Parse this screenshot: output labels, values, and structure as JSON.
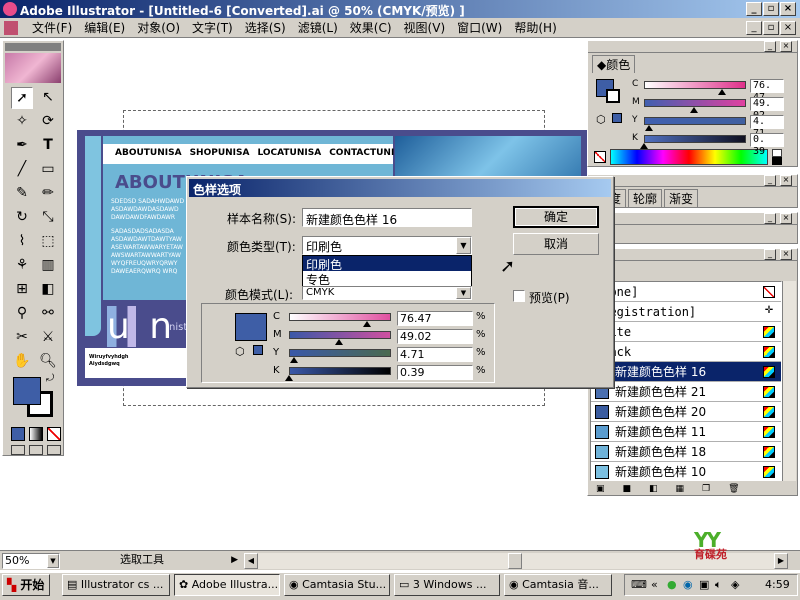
{
  "window": {
    "title": "Adobe Illustrator - [Untitled-6 [Converted].ai @ 50% (CMYK/预览) ]"
  },
  "menu": [
    "文件(F)",
    "编辑(E)",
    "对象(O)",
    "文字(T)",
    "选择(S)",
    "滤镜(L)",
    "效果(C)",
    "视图(V)",
    "窗口(W)",
    "帮助(H)"
  ],
  "colorPanel": {
    "tab": "颜色",
    "rows": [
      {
        "label": "C",
        "value": "76. 47"
      },
      {
        "label": "M",
        "value": "49. 02"
      },
      {
        "label": "Y",
        "value": "4. 71"
      },
      {
        "label": "K",
        "value": "0. 39"
      }
    ]
  },
  "panel2": {
    "tabs": [
      "明度",
      "轮廓",
      "渐变"
    ]
  },
  "panel3": {
    "tab": "层"
  },
  "swatchPanel": {
    "tab": "样",
    "items": [
      {
        "label": "[None]",
        "color": "#ffffff"
      },
      {
        "label": "[Registration]",
        "color": "#000000"
      },
      {
        "label": "White",
        "color": "#ffffff"
      },
      {
        "label": "Black",
        "color": "#000000"
      },
      {
        "label": "新建颜色色样 16",
        "color": "#3e5ea6",
        "selected": true
      },
      {
        "label": "新建颜色色样 21",
        "color": "#4a6fb0"
      },
      {
        "label": "新建颜色色样 20",
        "color": "#3a5ca0"
      },
      {
        "label": "新建颜色色样 11",
        "color": "#5a9ccf"
      },
      {
        "label": "新建颜色色样 18",
        "color": "#6fb2d8"
      },
      {
        "label": "新建颜色色样 10",
        "color": "#7bbfe0"
      }
    ]
  },
  "artwork": {
    "nav": [
      "ABOUTUNISA",
      "SHOPUNISA",
      "LOCATUNISA",
      "CONTACTUNISA"
    ],
    "heading": "ABOUTUNISA",
    "para1": [
      "SDEDSD SADAHWDAWD",
      "ASDAWDAWDASDAWD",
      "DAWDAWDFAWDAWR"
    ],
    "para2": [
      "SADASDADSADASDA",
      "ASDAWDAWTDAWTYAW",
      "ASEWARTAWWARYETAW",
      "AWSWARTAWWARTYAW",
      "WYQFREUQWRYQRWY",
      "DAWEAERQWRQ WRQ"
    ],
    "bigLetters": "u n",
    "small": "nistict",
    "footer": [
      "Wiruyfvyhdgh",
      "Aiydsdgwq"
    ]
  },
  "dialog": {
    "title": "色样选项",
    "nameLabel": "样本名称(S):",
    "nameValue": "新建颜色色样 16",
    "typeLabel": "颜色类型(T):",
    "typeValue": "印刷色",
    "typeOptions": [
      "印刷色",
      "专色"
    ],
    "modeLabel": "颜色模式(L):",
    "modeValue": "CMYK",
    "ok": "确定",
    "cancel": "取消",
    "preview": "预览(P)",
    "rows": [
      {
        "label": "C",
        "value": "76.47",
        "pct": "%",
        "frac": 0.7647
      },
      {
        "label": "M",
        "value": "49.02",
        "pct": "%",
        "frac": 0.4902
      },
      {
        "label": "Y",
        "value": "4.71",
        "pct": "%",
        "frac": 0.0471
      },
      {
        "label": "K",
        "value": "0.39",
        "pct": "%",
        "frac": 0.0039
      }
    ],
    "swatchColor": "#3e5ea6"
  },
  "statusbar": {
    "zoom": "50%",
    "tool": "选取工具"
  },
  "taskbar": {
    "start": "开始",
    "items": [
      "Illustrator cs ...",
      "Adobe Illustra...",
      "Camtasia Stu...",
      "3 Windows ...",
      "Camtasia 音..."
    ],
    "clock": "4:59"
  },
  "logo": {
    "text": "育碟苑"
  }
}
